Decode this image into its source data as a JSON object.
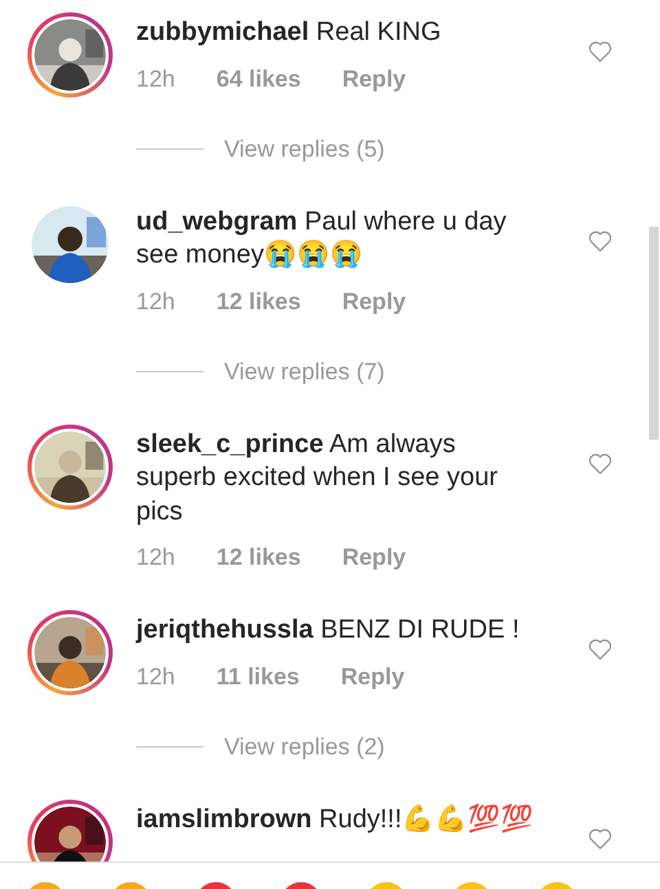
{
  "comments": [
    {
      "username": "zubbymichael",
      "text": "Real KING",
      "story": true,
      "time": "12h",
      "likes": "64 likes",
      "reply": "Reply",
      "liked": false,
      "view_replies": "View replies (5)"
    },
    {
      "username": "ud_webgram",
      "text": "Paul where u day see money😭😭😭",
      "story": false,
      "time": "12h",
      "likes": "12 likes",
      "reply": "Reply",
      "liked": false,
      "view_replies": "View replies (7)"
    },
    {
      "username": "sleek_c_prince",
      "text": "Am always superb excited when I see your pics",
      "story": true,
      "time": "12h",
      "likes": "12 likes",
      "reply": "Reply",
      "liked": false
    },
    {
      "username": "jeriqthehussla",
      "text": "BENZ DI RUDE !",
      "story": true,
      "time": "12h",
      "likes": "11 likes",
      "reply": "Reply",
      "liked": false,
      "view_replies": "View replies (2)"
    },
    {
      "username": "iamslimbrown",
      "text": "Rudy!!!💪💪💯💯",
      "story": true,
      "liked": false
    }
  ]
}
